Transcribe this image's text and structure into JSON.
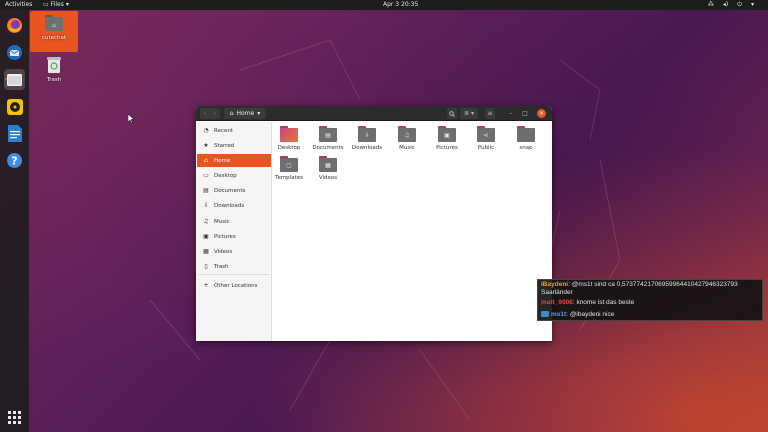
{
  "topbar": {
    "activities": "Activities",
    "app_menu": "Files",
    "clock": "Apr 3  20:35"
  },
  "desktop": {
    "icons": [
      {
        "label": "cutechat",
        "selected": true,
        "icon": "folder-icon"
      },
      {
        "label": "Trash",
        "selected": false,
        "icon": "trash-icon"
      }
    ]
  },
  "dock": {
    "items": [
      "firefox-icon",
      "thunderbird-icon",
      "files-icon",
      "rhythmbox-icon",
      "libreoffice-writer-icon",
      "help-icon",
      "show-apps-icon"
    ]
  },
  "window": {
    "path": "Home",
    "sidebar": [
      {
        "label": "Recent",
        "icon": "clock-icon",
        "active": false
      },
      {
        "label": "Starred",
        "icon": "star-icon",
        "active": false
      },
      {
        "label": "Home",
        "icon": "home-icon",
        "active": true
      },
      {
        "label": "Desktop",
        "icon": "desktop-icon",
        "active": false
      },
      {
        "label": "Documents",
        "icon": "document-icon",
        "active": false
      },
      {
        "label": "Downloads",
        "icon": "download-icon",
        "active": false
      },
      {
        "label": "Music",
        "icon": "music-icon",
        "active": false
      },
      {
        "label": "Pictures",
        "icon": "picture-icon",
        "active": false
      },
      {
        "label": "Videos",
        "icon": "video-icon",
        "active": false
      },
      {
        "label": "Trash",
        "icon": "trash-icon",
        "active": false
      },
      {
        "label": "Other Locations",
        "icon": "plus-icon",
        "active": false
      }
    ],
    "folders": [
      {
        "label": "Desktop",
        "icon": "desktop-folder-icon"
      },
      {
        "label": "Documents",
        "icon": "documents-folder-icon"
      },
      {
        "label": "Downloads",
        "icon": "downloads-folder-icon"
      },
      {
        "label": "Music",
        "icon": "music-folder-icon"
      },
      {
        "label": "Pictures",
        "icon": "pictures-folder-icon"
      },
      {
        "label": "Public",
        "icon": "public-folder-icon"
      },
      {
        "label": "snap",
        "icon": "folder-icon"
      },
      {
        "label": "Templates",
        "icon": "templates-folder-icon"
      },
      {
        "label": "Videos",
        "icon": "videos-folder-icon"
      }
    ]
  },
  "chat": {
    "messages": [
      {
        "user": "iBaydeni",
        "separator": ":",
        "text": "@ms1t sind ca 0,57377421706959964410427946323793",
        "cont": "Saarländer",
        "color": "#e8a23a",
        "badge": false
      },
      {
        "user": "matt_9908",
        "separator": ":",
        "text": "knome ist das beste",
        "cont": "",
        "color": "#e0443a",
        "badge": false
      },
      {
        "user": "ms1t",
        "separator": ":",
        "text": "@ibaydeni nice",
        "cont": "",
        "color": "#5aa0f0",
        "badge": true
      }
    ]
  },
  "colors": {
    "accent": "#e95420",
    "panel": "#1d1d1d",
    "headerbar": "#2c2c2c",
    "folder": "#6e6e6e",
    "desktop_folder": "#c44a7a"
  }
}
